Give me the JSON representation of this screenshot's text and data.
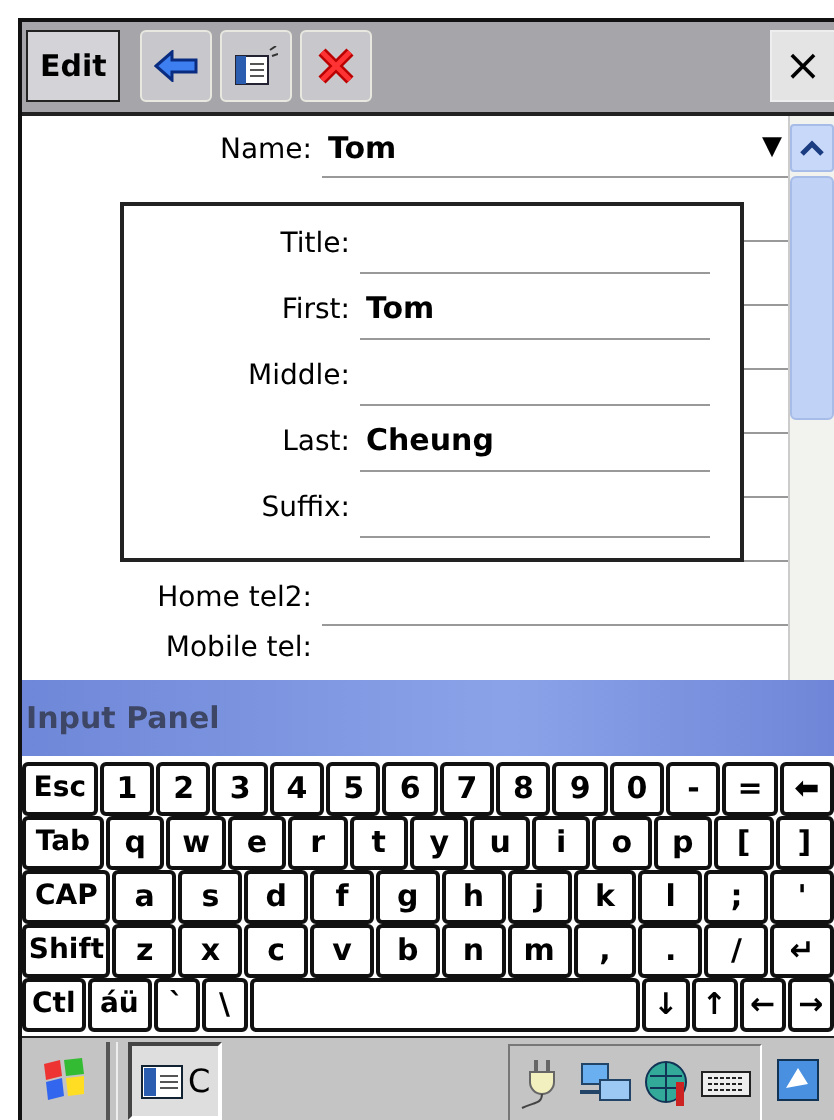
{
  "toolbar": {
    "menu": "Edit",
    "close": "×"
  },
  "form": {
    "name": {
      "label": "Name:",
      "value": "Tom",
      "dropdown": "▼"
    },
    "fields": [
      {
        "label": "Home tel2:"
      },
      {
        "label": "Mobile tel:"
      }
    ]
  },
  "name_popup": {
    "fields": [
      {
        "label": "Title:"
      },
      {
        "label": "First:",
        "value": "Tom"
      },
      {
        "label": "Middle:"
      },
      {
        "label": "Last:",
        "value": "Cheung"
      },
      {
        "label": "Suffix:"
      }
    ]
  },
  "input_panel": {
    "title": "Input Panel",
    "keyboard": [
      [
        {
          "kind": "key",
          "label": "Esc"
        },
        {
          "kind": "key",
          "label": "1"
        },
        {
          "kind": "key",
          "label": "2"
        },
        {
          "kind": "key",
          "label": "3"
        },
        {
          "kind": "key",
          "label": "4"
        },
        {
          "kind": "key",
          "label": "5"
        },
        {
          "kind": "key",
          "label": "6"
        },
        {
          "kind": "key",
          "label": "7"
        },
        {
          "kind": "key",
          "label": "8"
        },
        {
          "kind": "key",
          "label": "9"
        },
        {
          "kind": "key",
          "label": "0"
        },
        {
          "kind": "key",
          "label": "-"
        },
        {
          "kind": "key",
          "label": "="
        },
        {
          "kind": "key",
          "label": "⬅"
        }
      ],
      [
        {
          "kind": "key",
          "label": "Tab"
        },
        {
          "kind": "key",
          "label": "q"
        },
        {
          "kind": "key",
          "label": "w"
        },
        {
          "kind": "key",
          "label": "e"
        },
        {
          "kind": "key",
          "label": "r"
        },
        {
          "kind": "key",
          "label": "t"
        },
        {
          "kind": "key",
          "label": "y"
        },
        {
          "kind": "key",
          "label": "u"
        },
        {
          "kind": "key",
          "label": "i"
        },
        {
          "kind": "key",
          "label": "o"
        },
        {
          "kind": "key",
          "label": "p"
        },
        {
          "kind": "key",
          "label": "["
        },
        {
          "kind": "key",
          "label": "]"
        }
      ],
      [
        {
          "kind": "key",
          "label": "CAP"
        },
        {
          "kind": "key",
          "label": "a"
        },
        {
          "kind": "key",
          "label": "s"
        },
        {
          "kind": "key",
          "label": "d"
        },
        {
          "kind": "key",
          "label": "f"
        },
        {
          "kind": "key",
          "label": "g"
        },
        {
          "kind": "key",
          "label": "h"
        },
        {
          "kind": "key",
          "label": "j"
        },
        {
          "kind": "key",
          "label": "k"
        },
        {
          "kind": "key",
          "label": "l"
        },
        {
          "kind": "key",
          "label": ";"
        },
        {
          "kind": "key",
          "label": "'"
        }
      ],
      [
        {
          "kind": "key",
          "label": "Shift"
        },
        {
          "kind": "key",
          "label": "z"
        },
        {
          "kind": "key",
          "label": "x"
        },
        {
          "kind": "key",
          "label": "c"
        },
        {
          "kind": "key",
          "label": "v"
        },
        {
          "kind": "key",
          "label": "b"
        },
        {
          "kind": "key",
          "label": "n"
        },
        {
          "kind": "key",
          "label": "m"
        },
        {
          "kind": "key",
          "label": ","
        },
        {
          "kind": "key",
          "label": "."
        },
        {
          "kind": "key",
          "label": "/"
        },
        {
          "kind": "key",
          "label": "↵"
        }
      ],
      [
        {
          "kind": "key",
          "label": "Ctl"
        },
        {
          "kind": "key",
          "label": "áü"
        },
        {
          "kind": "key",
          "label": "`"
        },
        {
          "kind": "key",
          "label": "\\"
        },
        {
          "kind": "space"
        },
        {
          "kind": "key",
          "label": "↓"
        },
        {
          "kind": "key",
          "label": "↑"
        },
        {
          "kind": "key",
          "label": "←"
        },
        {
          "kind": "key",
          "label": "→"
        }
      ]
    ]
  },
  "taskbar": {
    "task": {
      "label": "C",
      "selected": true
    }
  }
}
